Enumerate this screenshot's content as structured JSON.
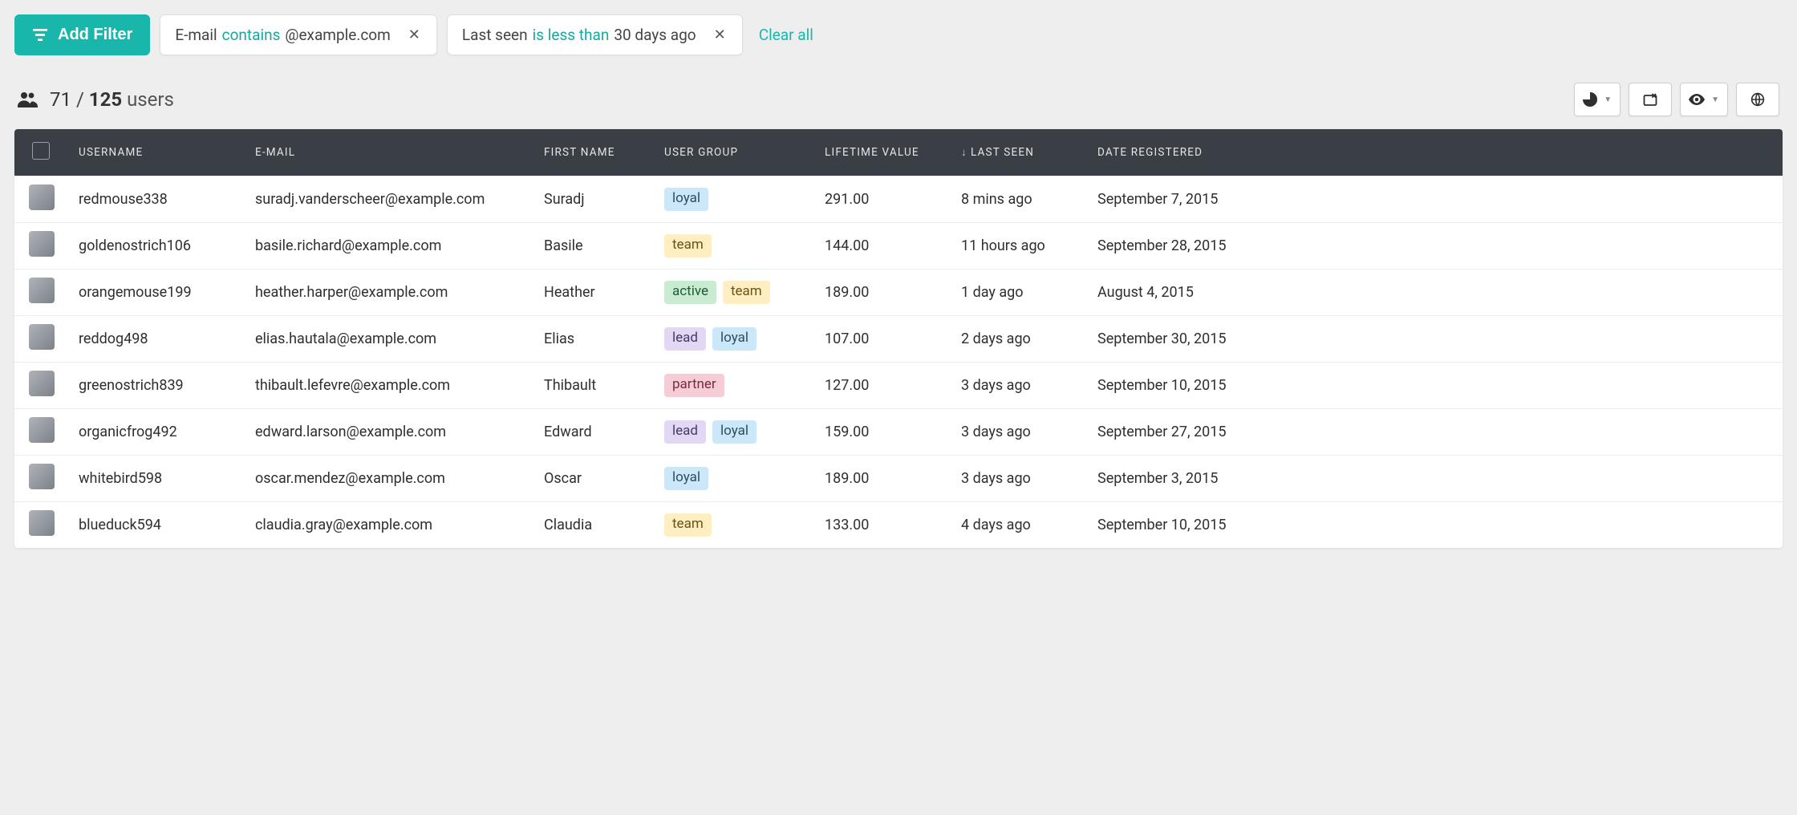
{
  "filterBar": {
    "addFilterLabel": "Add Filter",
    "clearAllLabel": "Clear all",
    "chips": [
      {
        "field": "E-mail",
        "op": "contains",
        "value": "@example.com"
      },
      {
        "field": "Last seen",
        "op": "is less than",
        "value": "30 days ago"
      }
    ]
  },
  "summary": {
    "shown": "71",
    "sep": " / ",
    "total": "125",
    "label": "users"
  },
  "columns": {
    "username": "Username",
    "email": "E-mail",
    "first_name": "First Name",
    "user_group": "User Group",
    "lifetime_value": "Lifetime Value",
    "last_seen": "Last Seen",
    "date_registered": "Date Registered"
  },
  "rows": [
    {
      "username": "redmouse338",
      "email": "suradj.vanderscheer@example.com",
      "first_name": "Suradj",
      "groups": [
        "loyal"
      ],
      "lifetime_value": "291.00",
      "last_seen": "8 mins ago",
      "date_registered": "September 7, 2015",
      "avatar_icon": "avatar"
    },
    {
      "username": "goldenostrich106",
      "email": "basile.richard@example.com",
      "first_name": "Basile",
      "groups": [
        "team"
      ],
      "lifetime_value": "144.00",
      "last_seen": "11 hours ago",
      "date_registered": "September 28, 2015",
      "avatar_icon": "avatar"
    },
    {
      "username": "orangemouse199",
      "email": "heather.harper@example.com",
      "first_name": "Heather",
      "groups": [
        "active",
        "team"
      ],
      "lifetime_value": "189.00",
      "last_seen": "1 day ago",
      "date_registered": "August 4, 2015",
      "avatar_icon": "avatar"
    },
    {
      "username": "reddog498",
      "email": "elias.hautala@example.com",
      "first_name": "Elias",
      "groups": [
        "lead",
        "loyal"
      ],
      "lifetime_value": "107.00",
      "last_seen": "2 days ago",
      "date_registered": "September 30, 2015",
      "avatar_icon": "avatar"
    },
    {
      "username": "greenostrich839",
      "email": "thibault.lefevre@example.com",
      "first_name": "Thibault",
      "groups": [
        "partner"
      ],
      "lifetime_value": "127.00",
      "last_seen": "3 days ago",
      "date_registered": "September 10, 2015",
      "avatar_icon": "avatar"
    },
    {
      "username": "organicfrog492",
      "email": "edward.larson@example.com",
      "first_name": "Edward",
      "groups": [
        "lead",
        "loyal"
      ],
      "lifetime_value": "159.00",
      "last_seen": "3 days ago",
      "date_registered": "September 27, 2015",
      "avatar_icon": "avatar"
    },
    {
      "username": "whitebird598",
      "email": "oscar.mendez@example.com",
      "first_name": "Oscar",
      "groups": [
        "loyal"
      ],
      "lifetime_value": "189.00",
      "last_seen": "3 days ago",
      "date_registered": "September 3, 2015",
      "avatar_icon": "avatar"
    },
    {
      "username": "blueduck594",
      "email": "claudia.gray@example.com",
      "first_name": "Claudia",
      "groups": [
        "team"
      ],
      "lifetime_value": "133.00",
      "last_seen": "4 days ago",
      "date_registered": "September 10, 2015",
      "avatar_icon": "avatar"
    }
  ]
}
